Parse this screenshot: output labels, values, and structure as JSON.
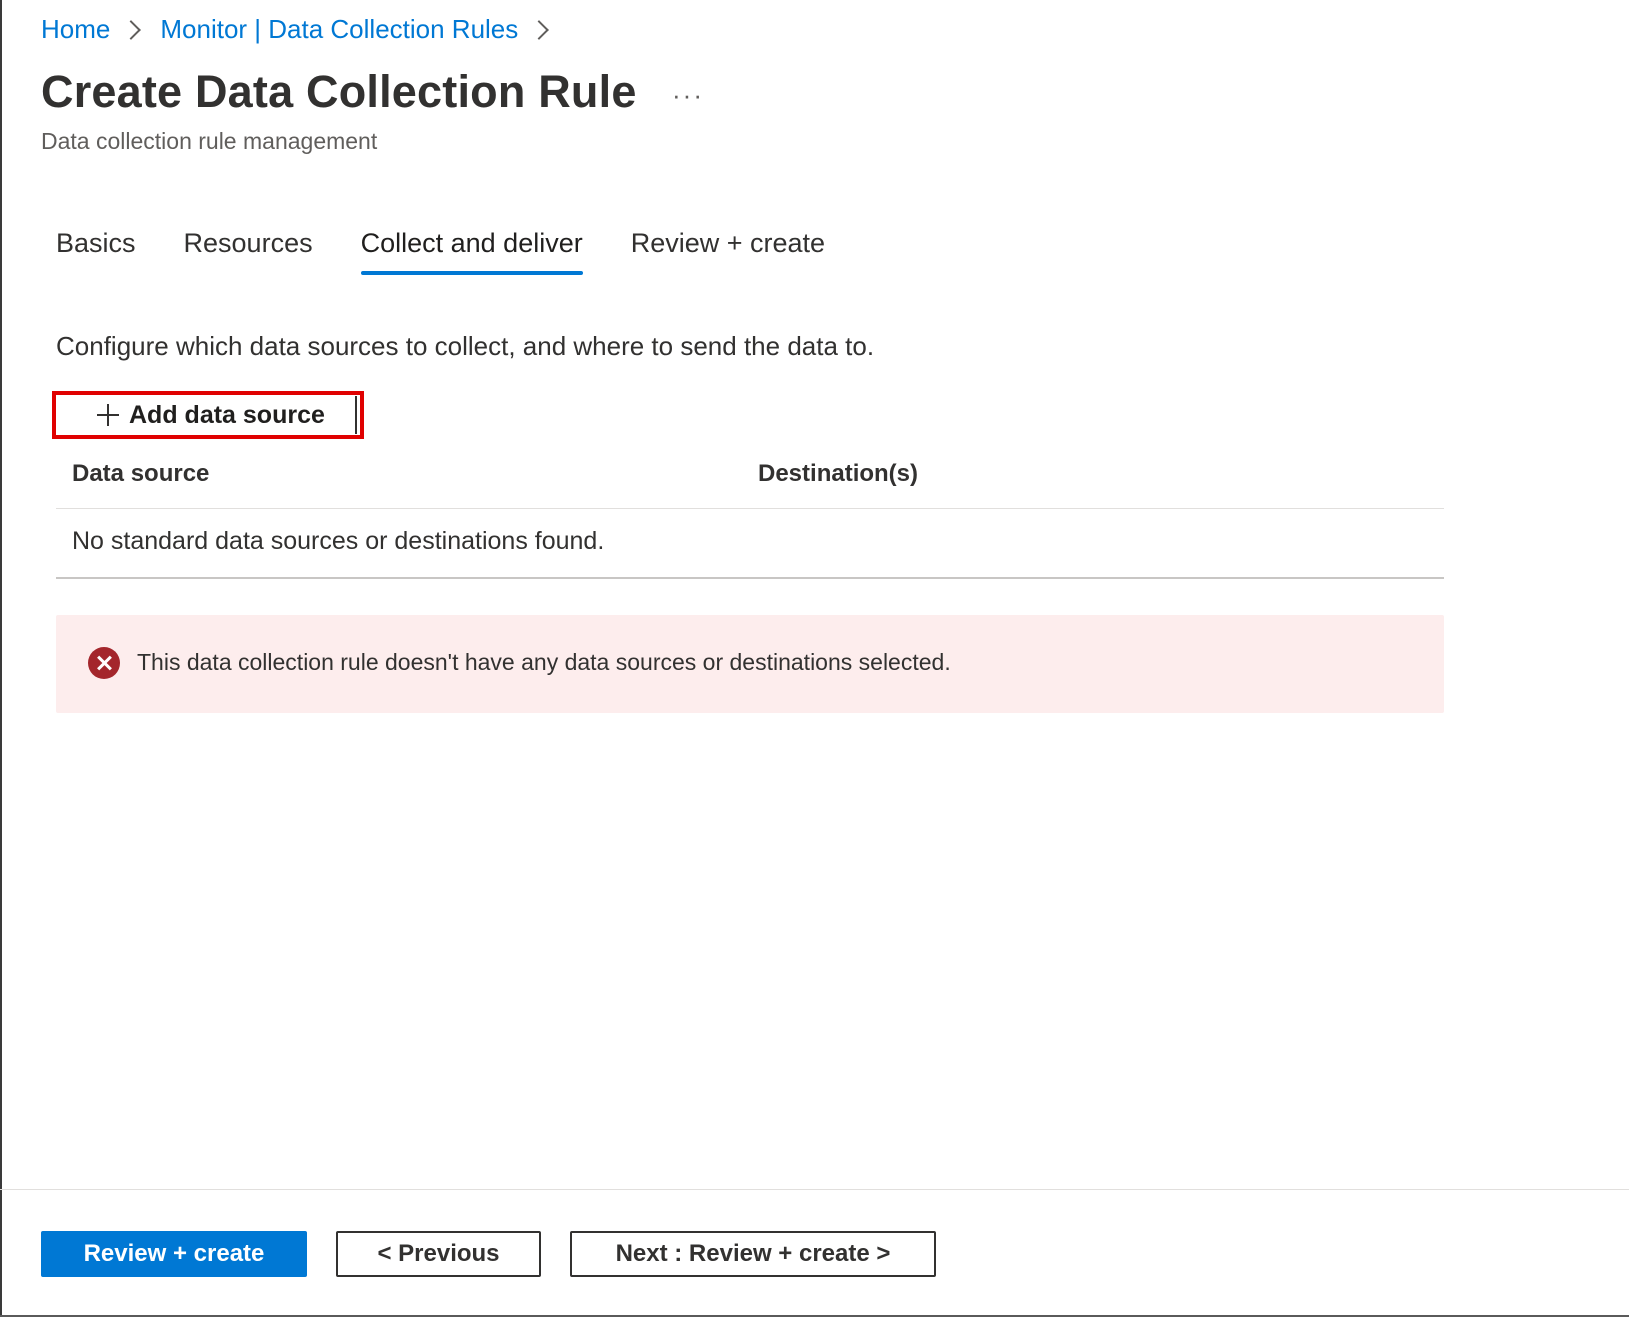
{
  "breadcrumb": {
    "items": [
      "Home",
      "Monitor | Data Collection Rules"
    ]
  },
  "header": {
    "title": "Create Data Collection Rule",
    "more": "···",
    "subtitle": "Data collection rule management"
  },
  "tabs": [
    {
      "label": "Basics",
      "active": false
    },
    {
      "label": "Resources",
      "active": false
    },
    {
      "label": "Collect and deliver",
      "active": true
    },
    {
      "label": "Review + create",
      "active": false
    }
  ],
  "main": {
    "description": "Configure which data sources to collect, and where to send the data to.",
    "add_button_label": "Add data source",
    "table": {
      "columns": [
        "Data source",
        "Destination(s)"
      ],
      "empty_message": "No standard data sources or destinations found."
    },
    "error": {
      "message": "This data collection rule doesn't have any data sources or destinations selected."
    }
  },
  "footer": {
    "review_create_label": "Review + create",
    "previous_label": "< Previous",
    "next_label": "Next : Review + create >"
  },
  "colors": {
    "accent": "#0078d4",
    "error": "#a4262c",
    "error_bg": "#fdeded",
    "highlight": "#e00000"
  }
}
